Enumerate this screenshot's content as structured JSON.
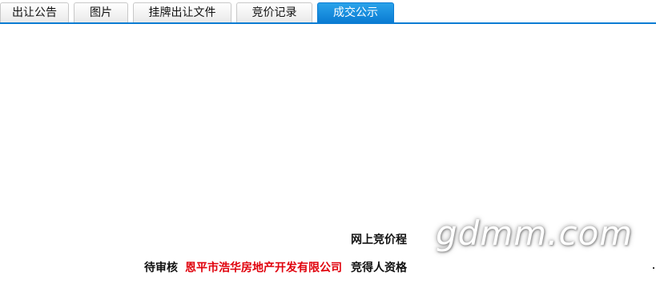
{
  "tabs": [
    {
      "label": "出让公告",
      "active": false
    },
    {
      "label": "图片",
      "active": false
    },
    {
      "label": "挂牌出让文件",
      "active": false
    },
    {
      "label": "竞价记录",
      "active": false
    },
    {
      "label": "成交公示",
      "active": true
    }
  ],
  "content": {
    "online_bid_process_label": "网上竞价程",
    "status_text": "待审核",
    "company_name": "恩平市浩华房地产开发有限公司",
    "bidder_qualification_label": "竞得人资格"
  },
  "watermark": {
    "text": "gdmm.com"
  },
  "colors": {
    "accent": "#0b7cd3",
    "active_tab": "#1a93e0",
    "highlight_red": "#e0000b"
  }
}
